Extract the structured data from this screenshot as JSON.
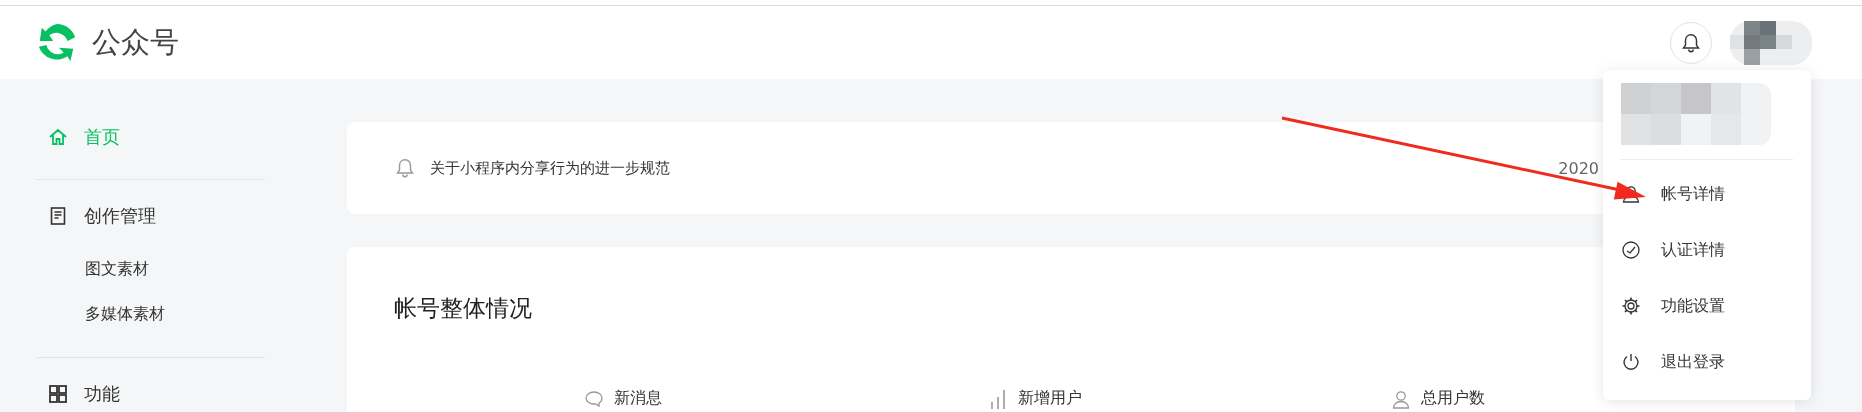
{
  "header": {
    "logo_text": "公众号"
  },
  "sidebar": {
    "sections": [
      {
        "label": "首页",
        "selected": true
      },
      {
        "label": "创作管理",
        "selected": false,
        "children": [
          {
            "label": "图文素材",
            "selected": false
          },
          {
            "label": "多媒体素材",
            "selected": false
          }
        ]
      },
      {
        "label": "功能",
        "selected": false
      }
    ]
  },
  "notice": {
    "text": "关于小程序内分享行为的进一步规范",
    "date": "2020"
  },
  "overview": {
    "title": "帐号整体情况",
    "stats": [
      {
        "label": "新消息"
      },
      {
        "label": "新增用户"
      },
      {
        "label": "总用户数"
      }
    ]
  },
  "account_menu": {
    "items": [
      {
        "label": "帐号详情"
      },
      {
        "label": "认证详情"
      },
      {
        "label": "功能设置"
      },
      {
        "label": "退出登录"
      }
    ]
  }
}
